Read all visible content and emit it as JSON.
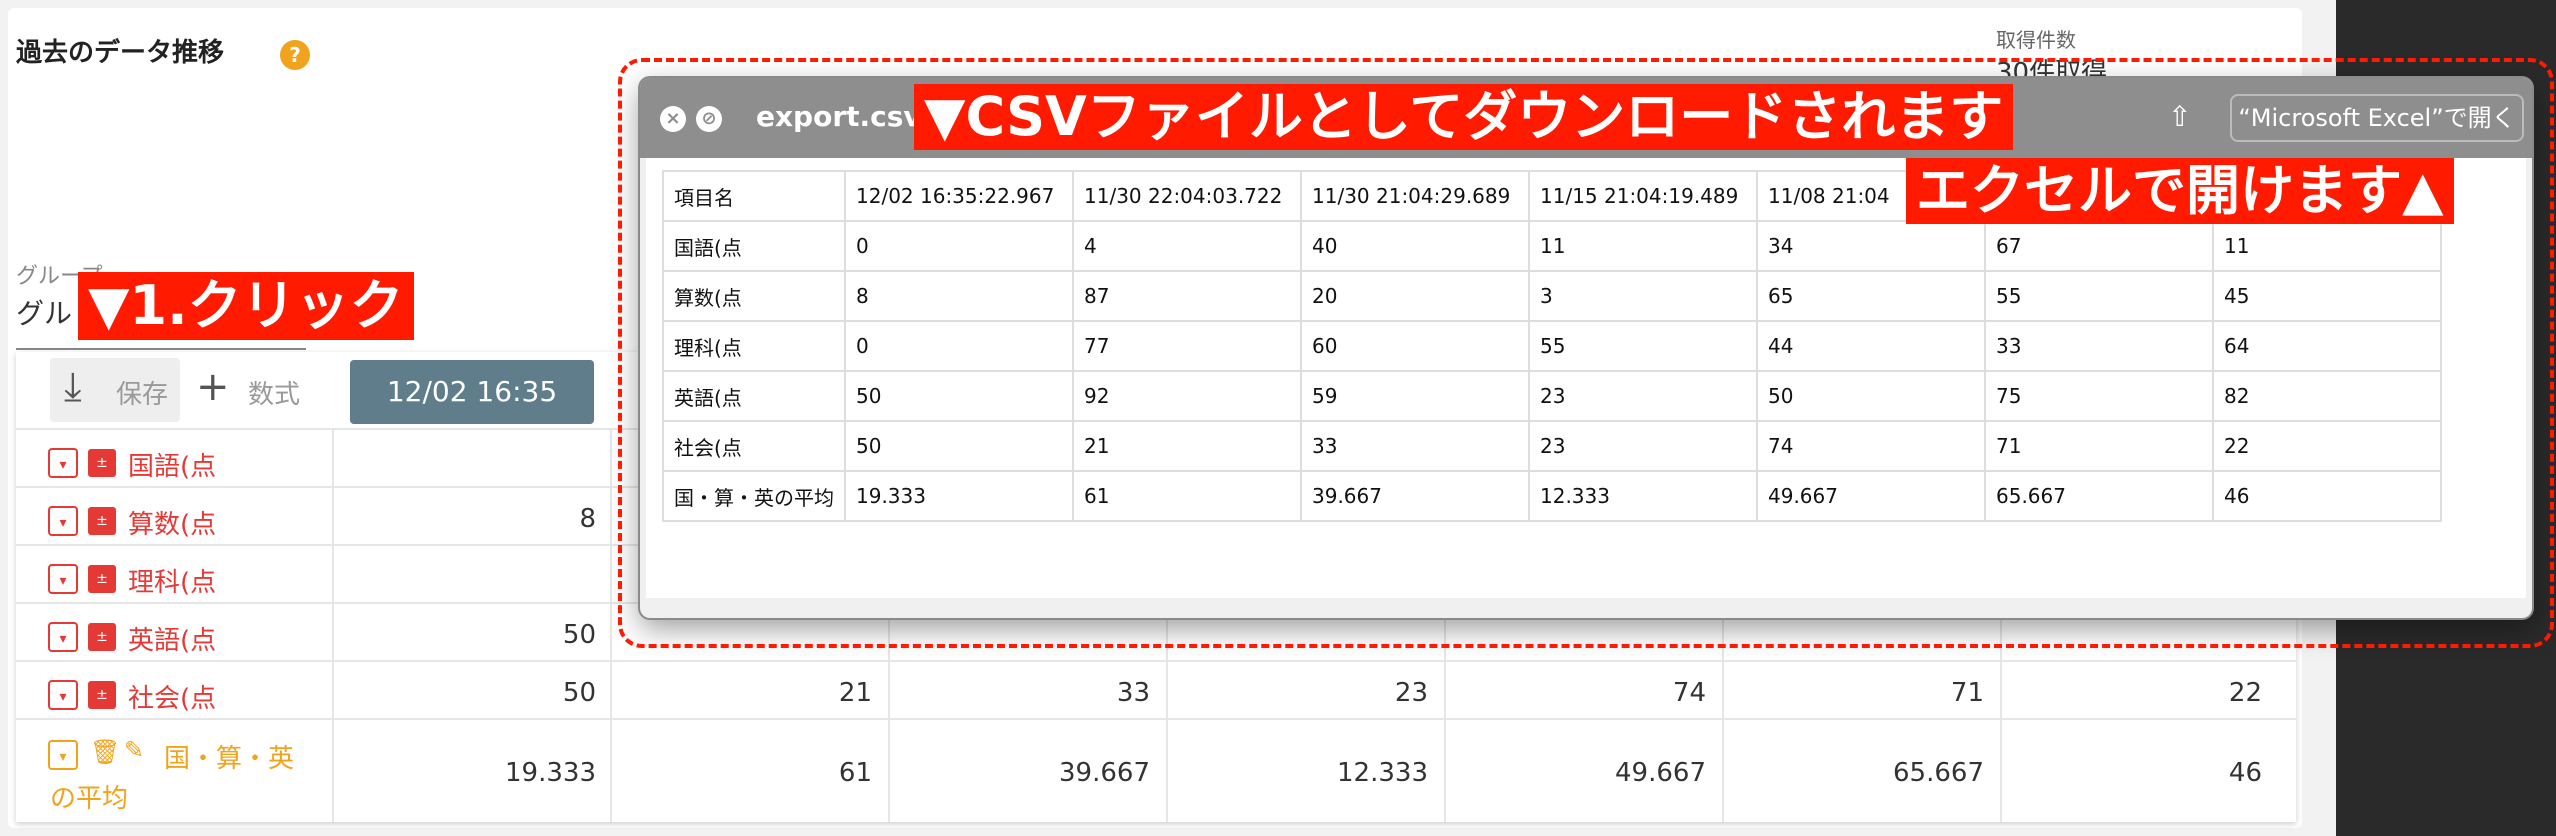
{
  "page": {
    "title": "過去のデータ推移",
    "help_icon": "?",
    "count_label": "取得件数",
    "count_value": "30件取得",
    "group_label": "グループ",
    "group_value": "グル"
  },
  "annotations": {
    "click": "▼1.クリック",
    "csv": "▼CSVファイルとしてダウンロードされます",
    "excel": "エクセルで開けます▲"
  },
  "toolbar": {
    "save_label": "保存",
    "formula_label": "数式",
    "date_label": "12/02 16:35"
  },
  "grid": {
    "rows": [
      {
        "name": "国語(点",
        "v": [
          "",
          "",
          "",
          "",
          "",
          "",
          ""
        ]
      },
      {
        "name": "算数(点",
        "v": [
          "8",
          "",
          "",
          "",
          "",
          "",
          ""
        ]
      },
      {
        "name": "理科(点",
        "v": [
          "",
          "",
          "",
          "",
          "",
          "",
          ""
        ]
      },
      {
        "name": "英語(点",
        "v": [
          "50",
          "",
          "",
          "",
          "",
          "",
          ""
        ]
      },
      {
        "name": "社会(点",
        "v": [
          "50",
          "21",
          "33",
          "23",
          "74",
          "71",
          "22"
        ]
      },
      {
        "name_line1": "国・算・英",
        "name_line2": "の平均",
        "v": [
          "19.333",
          "61",
          "39.667",
          "12.333",
          "49.667",
          "65.667",
          "46"
        ]
      }
    ]
  },
  "window": {
    "filename": "export.csv",
    "open_with": "“Microsoft Excel”で開く",
    "share_icon": "⇧"
  },
  "csv": {
    "header": [
      "項目名",
      "12/02 16:35:22.967",
      "11/30 22:04:03.722",
      "11/30 21:04:29.689",
      "11/15 21:04:19.489",
      "11/08 21:04",
      "",
      ""
    ],
    "rows": [
      [
        "国語(点",
        "0",
        "4",
        "40",
        "11",
        "34",
        "67",
        "11"
      ],
      [
        "算数(点",
        "8",
        "87",
        "20",
        "3",
        "65",
        "55",
        "45"
      ],
      [
        "理科(点",
        "0",
        "77",
        "60",
        "55",
        "44",
        "33",
        "64"
      ],
      [
        "英語(点",
        "50",
        "92",
        "59",
        "23",
        "50",
        "75",
        "82"
      ],
      [
        "社会(点",
        "50",
        "21",
        "33",
        "23",
        "74",
        "71",
        "22"
      ],
      [
        "国・算・英の平均",
        "19.333",
        "61",
        "39.667",
        "12.333",
        "49.667",
        "65.667",
        "46"
      ]
    ]
  }
}
